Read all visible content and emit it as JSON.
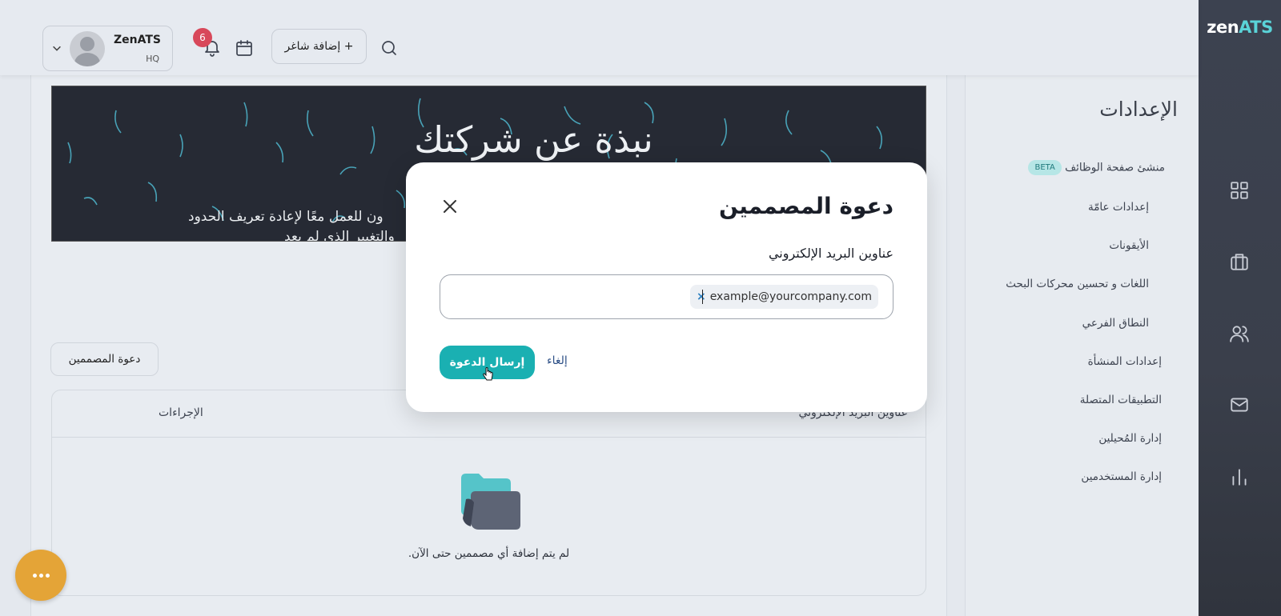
{
  "brand": {
    "logo_part1": "zen",
    "logo_part2": "ATS"
  },
  "topbar": {
    "user_name": "ZenATS",
    "user_sub": "HQ",
    "notifications_count": "6",
    "add_job_label": "+ إضافة شاغر"
  },
  "rail_icons": [
    "grid-icon",
    "briefcase-icon",
    "users-icon",
    "mail-icon",
    "chart-icon"
  ],
  "settings": {
    "title": "الإعدادات",
    "items": [
      {
        "label": "منشئ صفحة الوظائف",
        "badge": "BETA"
      },
      {
        "label": "إعدادات عامّة"
      },
      {
        "label": "الأيقونات"
      },
      {
        "label": "اللغات و تحسين محركات البحث"
      },
      {
        "label": "النطاق الفرعي"
      },
      {
        "label": "إعدادات المنشأة"
      },
      {
        "label": "التطبيقات المتصلة"
      },
      {
        "label": "إدارة المُحيلين"
      },
      {
        "label": "إدارة المستخدمين"
      }
    ],
    "active_index": 1
  },
  "banner": {
    "title": "نبذة عن شركتك",
    "text_line1": "ون للعمل معًا لإعادة تعريف الحدود",
    "text_line2": "والتغيير الذي لم يعد"
  },
  "main": {
    "invite_button": "دعوة المصممين",
    "table": {
      "col_actions": "الإجراءات",
      "col_emails": "عناوين البريد الإلكتروني",
      "empty_text": "لم يتم إضافة أي مصممين حتى الآن."
    }
  },
  "modal": {
    "title": "دعوة المصممين",
    "email_label": "عناوين البريد الإلكتروني",
    "email_chip": "example@yourcompany.com",
    "chip_remove": "×",
    "send_button": "إرسال الدعوة",
    "cancel_link": "إلغاء"
  },
  "colors": {
    "accent": "#1ab0b2",
    "fab": "#e4a437",
    "badge": "#d8485a",
    "rail": "#3c4250"
  }
}
